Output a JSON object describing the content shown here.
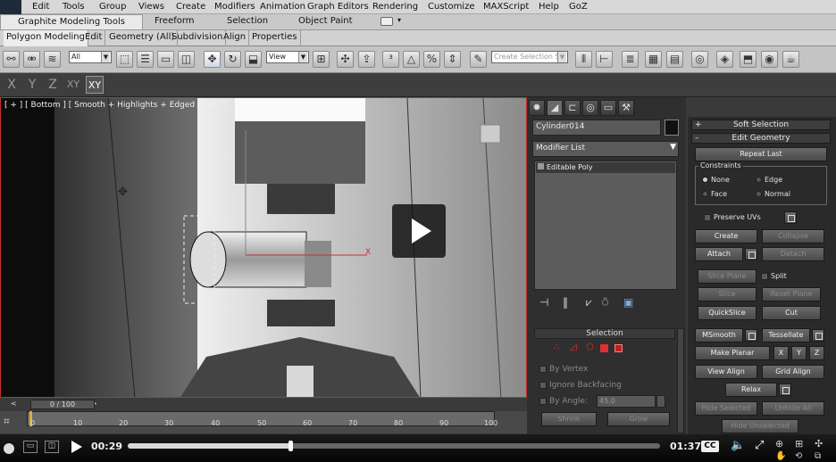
{
  "menu": {
    "items": [
      "Edit",
      "Tools",
      "Group",
      "Views",
      "Create",
      "Modifiers",
      "Animation",
      "Graph Editors",
      "Rendering",
      "Customize",
      "MAXScript",
      "Help",
      "GoZ"
    ]
  },
  "ribbon": {
    "tabs": [
      "Graphite Modeling Tools",
      "Freeform",
      "Selection",
      "Object Paint"
    ],
    "subtabs": [
      "Polygon Modeling",
      "Edit",
      "Geometry (All)",
      "Subdivision",
      "Align",
      "Properties"
    ]
  },
  "toolbar": {
    "filter_value": "All",
    "refcoord_value": "View",
    "selset_placeholder": "Create Selection S"
  },
  "axis": {
    "buttons": [
      "X",
      "Y",
      "Z",
      "XY",
      "XY"
    ]
  },
  "viewport": {
    "label": "[ + ] [ Bottom ] [ Smooth + Highlights + Edged Faces ]",
    "gizmo_axis": "X"
  },
  "command_panel": {
    "object_name": "Cylinder014",
    "modifier_list": "Modifier List",
    "stack_item": "Editable Poly",
    "selection": {
      "header": "Selection",
      "by_vertex": "By Vertex",
      "ignore_backfacing": "Ignore Backfacing",
      "by_angle": "By Angle:",
      "angle_value": "45.0",
      "shrink": "Shrink",
      "grow": "Grow"
    }
  },
  "rollout": {
    "soft_selection": "Soft Selection",
    "edit_geometry": "Edit Geometry",
    "repeat_last": "Repeat Last",
    "constraints": "Constraints",
    "none": "None",
    "edge": "Edge",
    "face": "Face",
    "normal": "Normal",
    "preserve_uvs": "Preserve UVs",
    "create": "Create",
    "collapse": "Collapse",
    "attach": "Attach",
    "detach": "Detach",
    "slice_plane": "Slice Plane",
    "split": "Split",
    "slice": "Slice",
    "reset_plane": "Reset Plane",
    "quickslice": "QuickSlice",
    "cut": "Cut",
    "msmooth": "MSmooth",
    "tessellate": "Tessellate",
    "make_planar": "Make Planar",
    "x": "X",
    "y": "Y",
    "z": "Z",
    "view_align": "View Align",
    "grid_align": "Grid Align",
    "relax": "Relax",
    "hide_selected": "Hide Selected",
    "unhide_all": "Unhide All",
    "hide_unselected": "Hide Unselected"
  },
  "timeline": {
    "frame_display": "0 / 100",
    "ticks": [
      "0",
      "10",
      "20",
      "30",
      "40",
      "50",
      "60",
      "70",
      "80",
      "90",
      "100"
    ]
  },
  "player": {
    "current_time": "00:29",
    "duration": "01:37",
    "cc_label": "CC",
    "progress": 0.305
  }
}
